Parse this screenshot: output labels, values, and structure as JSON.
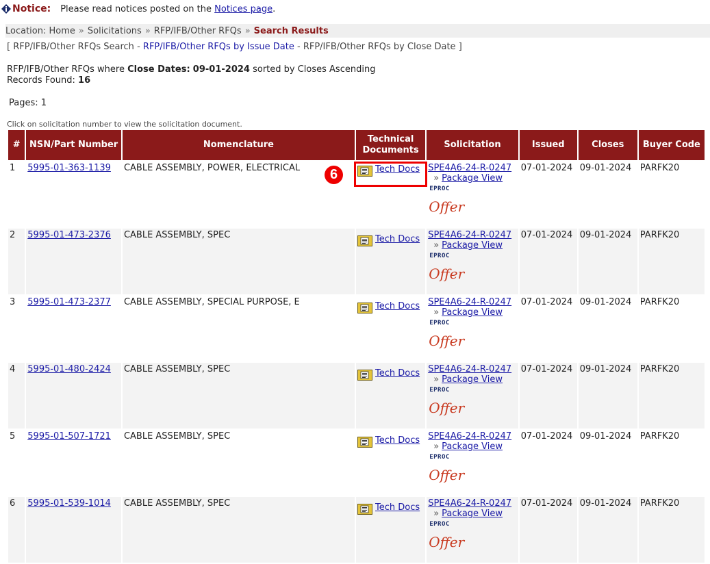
{
  "notice": {
    "label": "Notice:",
    "text": "Please read notices posted on the",
    "link": "Notices page",
    "suffix": "."
  },
  "location": {
    "label": "Location:",
    "crumbs": [
      "Home",
      "Solicitations",
      "RFP/IFB/Other RFQs"
    ],
    "separator": "»",
    "current": "Search Results"
  },
  "search_links": {
    "open": "[",
    "search": "RFP/IFB/Other RFQs Search",
    "dash1": "-",
    "by_issue": "RFP/IFB/Other RFQs by Issue Date",
    "dash2": "-",
    "by_close": "RFP/IFB/Other RFQs by Close Date",
    "close": "]"
  },
  "summary": {
    "prefix": "RFP/IFB/Other RFQs where",
    "criteria_label": "Close Dates:",
    "criteria_value": "09-01-2024",
    "sort_text": "sorted by Closes Ascending",
    "records_label": "Records Found:",
    "records_value": "16"
  },
  "pages": "Pages: 1",
  "hint": "Click on solicitation number to view the solicitation document.",
  "columns": [
    "#",
    "NSN/Part Number",
    "Nomenclature",
    "Technical Documents",
    "Solicitation",
    "Issued",
    "Closes",
    "Buyer Code"
  ],
  "tech_docs_label": "Tech Docs",
  "package_view_label": "Package View",
  "package_arrow": "»",
  "eproc_label": "EPROC",
  "offer_label": "Offer",
  "step_badge": "6",
  "rows": [
    {
      "num": "1",
      "nsn": "5995-01-363-1139",
      "nomenclature": "CABLE ASSEMBLY, POWER, ELECTRICAL",
      "solicitation": "SPE4A6-24-R-0247",
      "issued": "07-01-2024",
      "closes": "09-01-2024",
      "buyer": "PARFK20"
    },
    {
      "num": "2",
      "nsn": "5995-01-473-2376",
      "nomenclature": "CABLE ASSEMBLY, SPEC",
      "solicitation": "SPE4A6-24-R-0247",
      "issued": "07-01-2024",
      "closes": "09-01-2024",
      "buyer": "PARFK20"
    },
    {
      "num": "3",
      "nsn": "5995-01-473-2377",
      "nomenclature": "CABLE ASSEMBLY, SPECIAL PURPOSE, E",
      "solicitation": "SPE4A6-24-R-0247",
      "issued": "07-01-2024",
      "closes": "09-01-2024",
      "buyer": "PARFK20"
    },
    {
      "num": "4",
      "nsn": "5995-01-480-2424",
      "nomenclature": "CABLE ASSEMBLY, SPEC",
      "solicitation": "SPE4A6-24-R-0247",
      "issued": "07-01-2024",
      "closes": "09-01-2024",
      "buyer": "PARFK20"
    },
    {
      "num": "5",
      "nsn": "5995-01-507-1721",
      "nomenclature": "CABLE ASSEMBLY, SPEC",
      "solicitation": "SPE4A6-24-R-0247",
      "issued": "07-01-2024",
      "closes": "09-01-2024",
      "buyer": "PARFK20"
    },
    {
      "num": "6",
      "nsn": "5995-01-539-1014",
      "nomenclature": "CABLE ASSEMBLY, SPEC",
      "solicitation": "SPE4A6-24-R-0247",
      "issued": "07-01-2024",
      "closes": "09-01-2024",
      "buyer": "PARFK20"
    }
  ]
}
